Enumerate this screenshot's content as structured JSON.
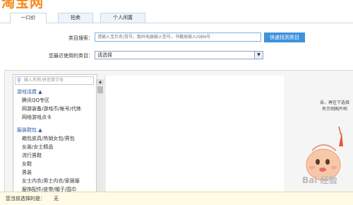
{
  "logo": "淘宝网",
  "tabs": [
    {
      "label": "一口价",
      "active": true
    },
    {
      "label": "拍卖",
      "active": false
    },
    {
      "label": "个人闲置",
      "active": false
    }
  ],
  "search": {
    "label": "类目搜索：",
    "placeholder": "请输入宝贝名/货号，数码电器输入型号，书籍类输入ISBN号",
    "button": "快速找到类目"
  },
  "recent": {
    "label": "您最近使用的类目：",
    "value": "请选择"
  },
  "category_filter": {
    "placeholder": "输入名称/拼音首字母"
  },
  "groups": [
    {
      "title": "游戏话费",
      "items": [
        "腾讯QQ专区",
        "网游装备/游戏币/帐号/代练",
        "网络游戏点卡"
      ]
    },
    {
      "title": "服装鞋包",
      "items": [
        "箱包皮具/热销女包/男包",
        "女装/女士精品",
        "流行男鞋",
        "女鞋",
        "男装",
        "女士内衣/男士内衣/家居服",
        "服饰配件/皮带/帽子/围巾"
      ]
    }
  ],
  "hint": [
    "亲，再往下选择",
    "有示例图片哟"
  ],
  "bottom": {
    "label": "您当前选择的是：",
    "value": "无"
  },
  "watermark": "Bai 经验"
}
